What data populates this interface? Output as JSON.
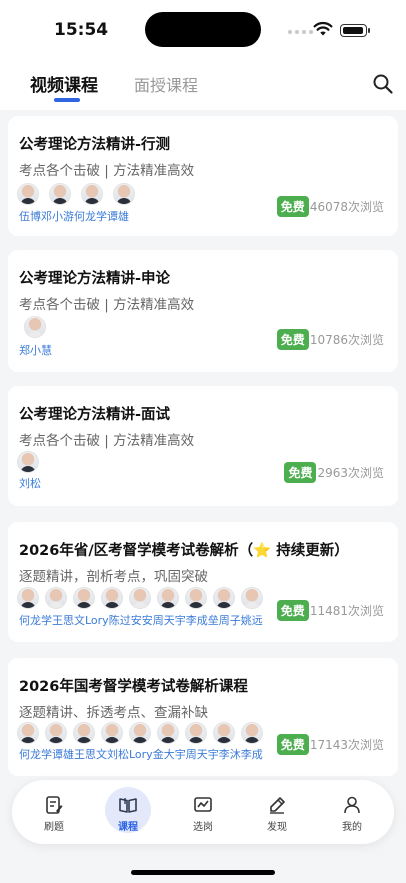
{
  "status": {
    "time": "15:54"
  },
  "header": {
    "tab_active": "视频课程",
    "tab_inactive": "面授课程"
  },
  "courses": [
    {
      "title": "公考理论方法精讲-行测",
      "subtitle": "考点各个击破 | 方法精准高效",
      "teachers": "伍博邓小游何龙学谭雄",
      "badge": "免费",
      "views": "46078次浏览"
    },
    {
      "title": "公考理论方法精讲-申论",
      "subtitle": "考点各个击破 | 方法精准高效",
      "teachers": "郑小慧",
      "badge": "免费",
      "views": "10786次浏览"
    },
    {
      "title": "公考理论方法精讲-面试",
      "subtitle": "考点各个击破 | 方法精准高效",
      "teachers": "刘松",
      "badge": "免费",
      "views": "2963次浏览"
    },
    {
      "title": "2026年省/区考督学模考试卷解析（⭐ 持续更新）",
      "subtitle": "逐题精讲，剖析考点，巩固突破",
      "teachers": "何龙学王思文Lory陈过安安周天宇李成垒周子姚远",
      "badge": "免费",
      "views": "11481次浏览"
    },
    {
      "title": "2026年国考督学模考试卷解析课程",
      "subtitle": "逐题精讲、拆透考点、查漏补缺",
      "teachers": "何龙学谭雄王思文刘松Lory金大宇周天宇李沐李成",
      "badge": "免费",
      "views": "17143次浏览"
    }
  ],
  "tabbar": {
    "items": [
      {
        "label": "刷题",
        "icon": "edit-icon"
      },
      {
        "label": "课程",
        "icon": "book-icon"
      },
      {
        "label": "选岗",
        "icon": "chart-icon"
      },
      {
        "label": "发现",
        "icon": "pen-icon"
      },
      {
        "label": "我的",
        "icon": "user-icon"
      }
    ]
  },
  "colors": {
    "accent": "#2f64e3",
    "badge": "#4cae4f",
    "teacher_link": "#3b7bd8"
  }
}
